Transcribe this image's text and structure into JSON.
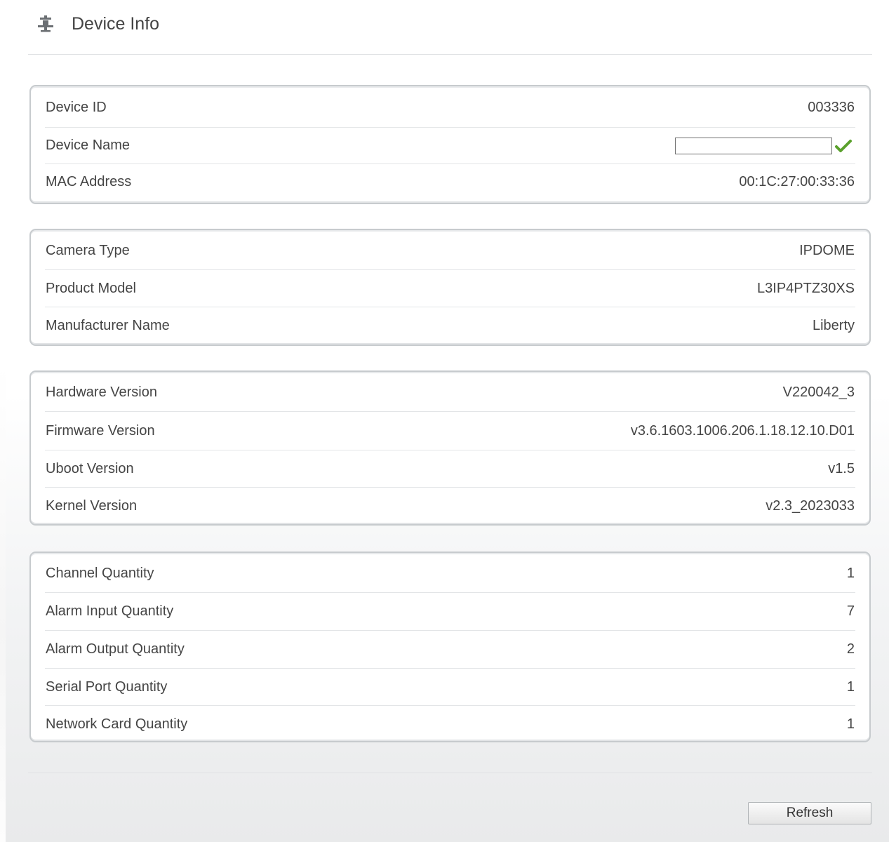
{
  "header": {
    "title": "Device Info",
    "icon": "device-info-icon"
  },
  "sections": [
    {
      "rows": [
        {
          "label": "Device ID",
          "value": "003336"
        },
        {
          "label": "Device Name",
          "value": ""
        },
        {
          "label": "MAC Address",
          "value": "00:1C:27:00:33:36"
        }
      ]
    },
    {
      "rows": [
        {
          "label": "Camera Type",
          "value": "IPDOME"
        },
        {
          "label": "Product Model",
          "value": "L3IP4PTZ30XS"
        },
        {
          "label": "Manufacturer Name",
          "value": "Liberty"
        }
      ]
    },
    {
      "rows": [
        {
          "label": "Hardware Version",
          "value": "V220042_3"
        },
        {
          "label": "Firmware Version",
          "value": "v3.6.1603.1006.206.1.18.12.10.D01"
        },
        {
          "label": "Uboot Version",
          "value": "v1.5"
        },
        {
          "label": "Kernel Version",
          "value": "v2.3_2023033"
        }
      ]
    },
    {
      "rows": [
        {
          "label": "Channel Quantity",
          "value": "1"
        },
        {
          "label": "Alarm Input Quantity",
          "value": "7"
        },
        {
          "label": "Alarm Output Quantity",
          "value": "2"
        },
        {
          "label": "Serial Port Quantity",
          "value": "1"
        },
        {
          "label": "Network Card Quantity",
          "value": "1"
        }
      ]
    }
  ],
  "device_name_input": {
    "value": "",
    "confirm_icon": "check-icon",
    "confirm_color": "#5aa02c"
  },
  "footer": {
    "refresh_label": "Refresh"
  }
}
